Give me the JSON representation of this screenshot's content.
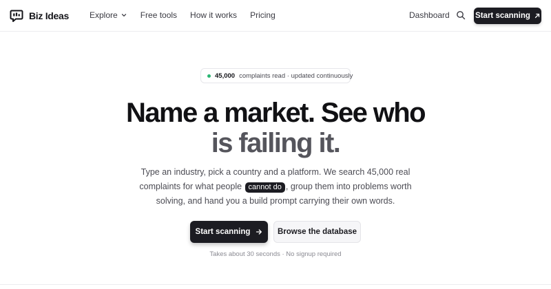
{
  "brand": {
    "name": "Biz Ideas",
    "logo_icon": "chat-bubble-icon"
  },
  "nav": {
    "items": [
      {
        "label": "Explore",
        "has_dropdown": true
      },
      {
        "label": "Free tools"
      },
      {
        "label": "How it works"
      },
      {
        "label": "Pricing"
      }
    ],
    "dashboard_label": "Dashboard",
    "search_icon": "search-icon",
    "cta_label": "Start scanning",
    "cta_icon": "arrow-up-right-icon"
  },
  "hero": {
    "badge": {
      "count": "45,000",
      "text": "complaints read · updated continuously",
      "dot_color": "#2bb673"
    },
    "headline": {
      "line1": "Name a market. See who",
      "line2": "is failing it."
    },
    "subtitle": {
      "line1": "Type an industry, pick a country and a platform. We search 45,000 real",
      "line2_before": "complaints for what people ",
      "line2_highlight": "cannot do",
      "line2_after": ", group them into problems worth",
      "line3": "solving, and hand you a build prompt carrying their own words."
    },
    "primary_button": "Start scanning",
    "primary_icon": "arrow-right-icon",
    "secondary_button": "Browse the database",
    "note": "Takes about 30 seconds · No signup required"
  },
  "colors": {
    "accent_dark": "#1c1c22",
    "text_muted": "#55555c",
    "badge_dot": "#2bb673"
  }
}
